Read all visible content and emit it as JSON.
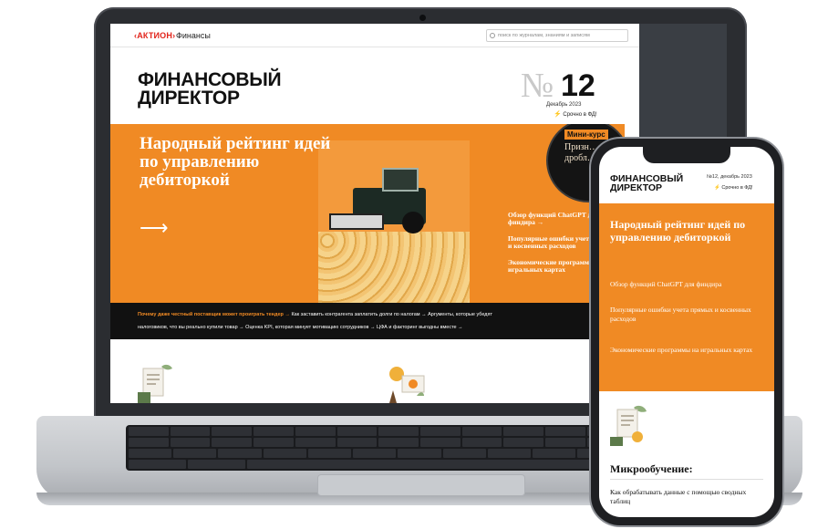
{
  "laptop_page": {
    "brand_logo": "‹АКТИОН›",
    "brand_section": "Финансы",
    "search_placeholder": "поиск по журналам, знаниям и записям",
    "magazine_title_line1": "ФИНАНСОВЫЙ",
    "magazine_title_line2": "ДИРЕКТОР",
    "issue_sign": "№",
    "issue_number": "12",
    "issue_date": "Декабрь 2023",
    "issue_link": "Срочно в ФД!",
    "hero_headline": "Народный рейтинг идей по управлению дебиторкой",
    "hero_arrow": "⟶",
    "mini_course_label": "Мини-курс",
    "mini_course_sub": "Призн… дробл…",
    "hero_links": [
      "Обзор функций ChatGPT для финдира →",
      "Популярные ошибки учета прямых и косвенных расходов",
      "Экономические программы на игральных картах"
    ],
    "ticker_line1_highlight": "Почему даже честный поставщик может проиграть тендер",
    "ticker_line1_rest": "Как заставить контрагента заплатить долги по налогам → Аргументы, которые убедят",
    "ticker_line2": "налоговиков, что вы реально купили товар → Оценка KPI, которая минует мотивацию сотрудников → ЦФА и факторинг выгодны вместе →"
  },
  "phone_page": {
    "title_line1": "ФИНАНСОВЫЙ",
    "title_line2": "ДИРЕКТОР",
    "issue": "№12, декабрь 2023",
    "issue_link": "Срочно в ФД!",
    "hero_headline": "Народный рейтинг идей по управлению дебиторкой",
    "links": [
      "Обзор функций ChatGPT для финдира",
      "Популярные ошибки учета прямых и косвенных расходов",
      "Экономические программы на игральных картах"
    ],
    "section_title": "Микрообучение:",
    "course_title": "Как обрабатывать данные с помощью сводных таблиц"
  },
  "colors": {
    "accent_orange": "#f08a24",
    "brand_red": "#e2231a",
    "ticker_bg": "#111111"
  },
  "icons": [
    "search-icon",
    "bolt-icon",
    "arrow-right-icon",
    "document-award-icon",
    "chart-coins-icon",
    "camera-icon"
  ]
}
